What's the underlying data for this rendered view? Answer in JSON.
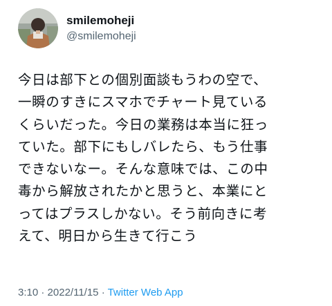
{
  "user": {
    "display_name": "smilemoheji",
    "handle": "@smilemoheji",
    "avatar_icon": "user-avatar-photo"
  },
  "tweet": {
    "lines": [
      "今日は部下との個別面談もうわの空で、",
      "一瞬のすきにスマホでチャート見ている",
      "くらいだった。今日の業務は本当に狂っ",
      "ていた。部下にもしバレたら、もう仕事",
      "できないなー。そんな意味では、この中",
      "毒から解放されたかと思うと、本業にと",
      "ってはプラスしかない。そう前向きに考",
      "えて、明日から生きて行こう"
    ]
  },
  "meta": {
    "time": "3:10",
    "separator": "·",
    "date": "2022/11/15",
    "source": "Twitter Web App"
  },
  "colors": {
    "text": "#0f1419",
    "muted": "#536471",
    "link": "#1d9bf0"
  }
}
